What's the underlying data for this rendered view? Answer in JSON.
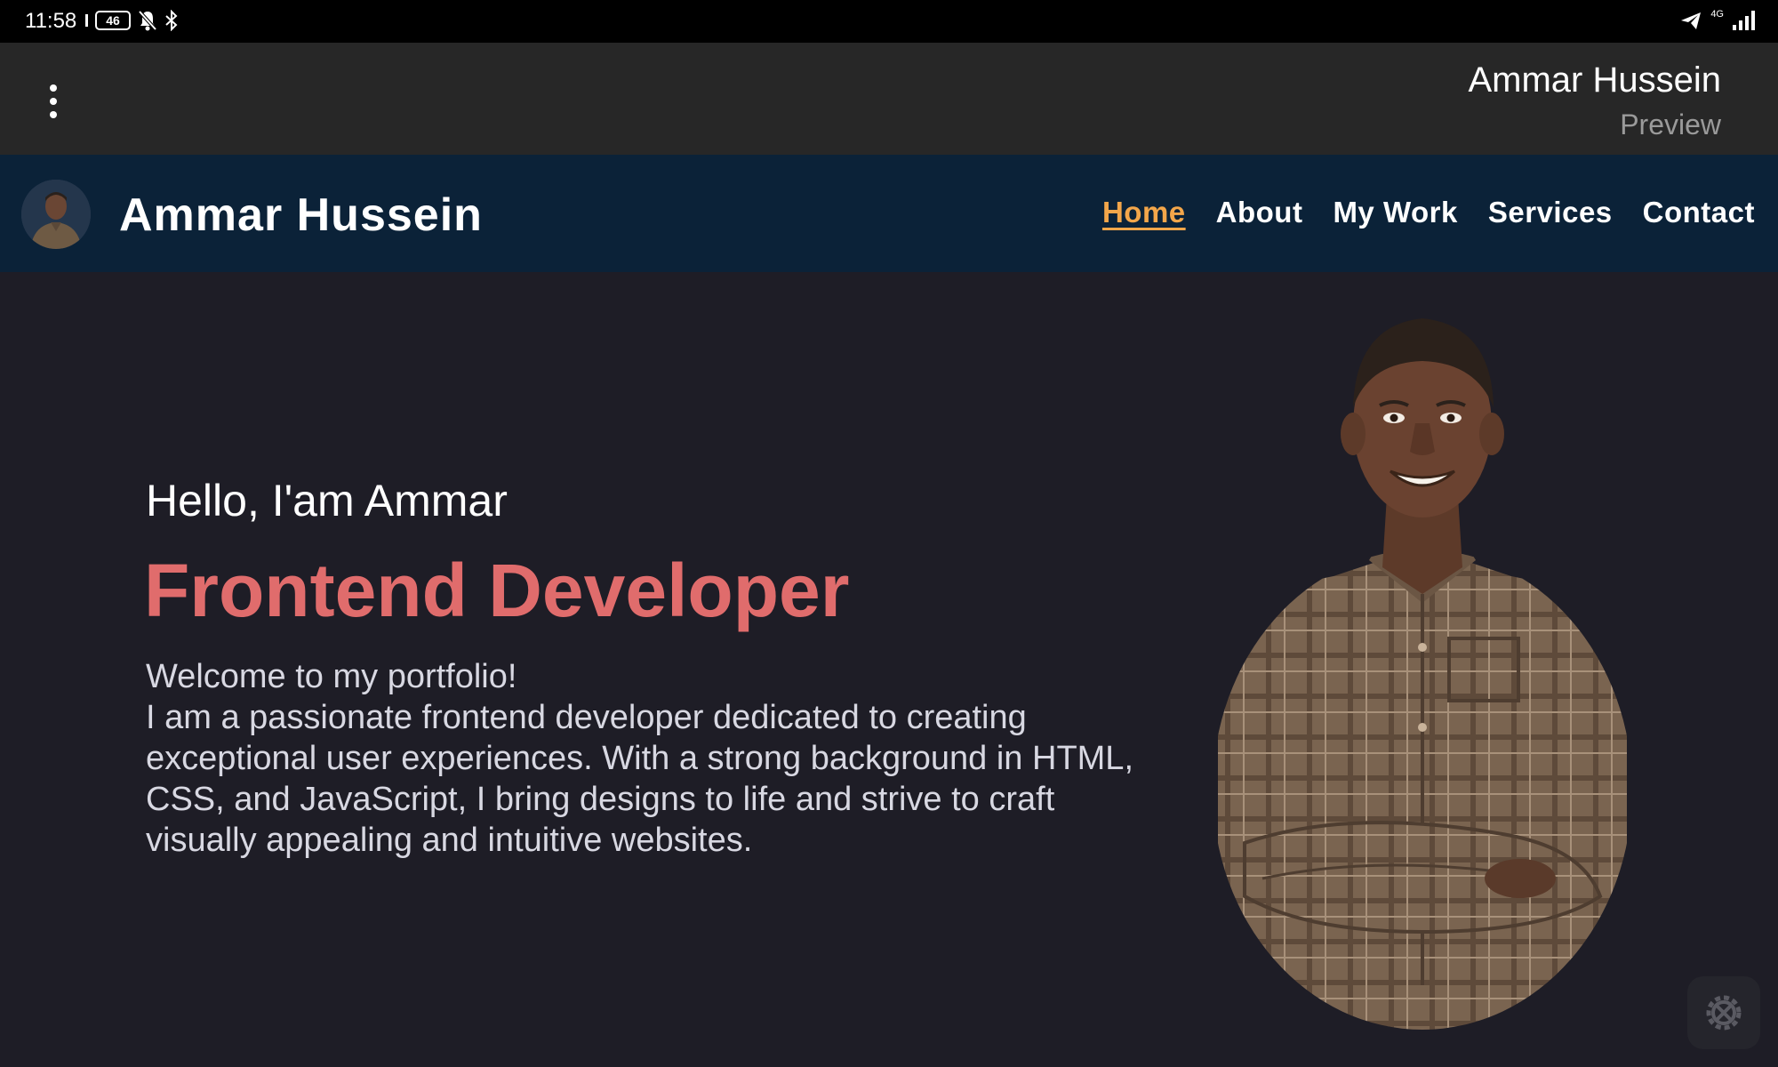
{
  "status_bar": {
    "time": "11:58",
    "battery": "46",
    "network": "4G"
  },
  "app_header": {
    "title": "Ammar Hussein",
    "subtitle": "Preview"
  },
  "site": {
    "brand": "Ammar Hussein",
    "nav": [
      {
        "label": "Home",
        "active": true
      },
      {
        "label": "About",
        "active": false
      },
      {
        "label": "My Work",
        "active": false
      },
      {
        "label": "Services",
        "active": false
      },
      {
        "label": "Contact",
        "active": false
      }
    ]
  },
  "hero": {
    "greeting": "Hello, I'am Ammar",
    "role": "Frontend Developer",
    "welcome": "Welcome to my portfolio!",
    "bio_lines": [
      "I am a passionate frontend developer dedicated to creating",
      "exceptional user experiences. With a strong background in HTML,",
      "CSS, and JavaScript, I bring designs to life and strive to craft",
      "visually appealing and intuitive websites."
    ]
  },
  "colors": {
    "accent_active": "#f3a64a",
    "role_color": "#e06c6c",
    "nav_bg": "#0b2238",
    "page_bg": "#1e1d26"
  },
  "icons": {
    "menu": "more-vertical-icon",
    "fab": "gear-icon"
  }
}
